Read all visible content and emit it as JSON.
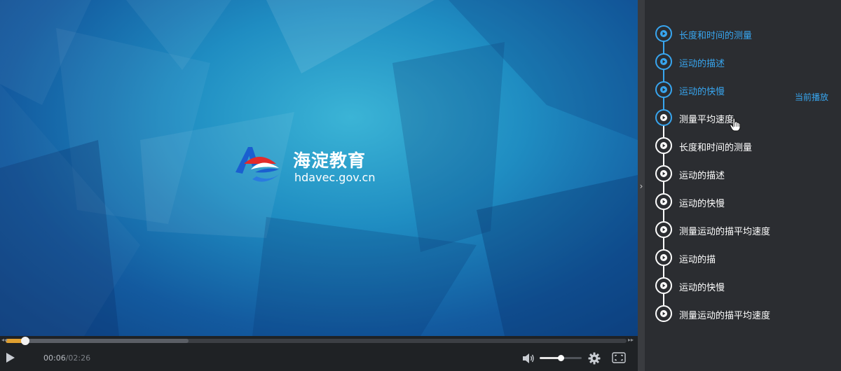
{
  "video": {
    "brand_title": "海淀教育",
    "brand_url": "hdavec.gov.cn",
    "background_color": "#1f8dc2"
  },
  "controls": {
    "play_icon": "play-icon",
    "current_time": "00:06",
    "duration": "/02:26",
    "progress_percent": 3.2,
    "buffered_percent": 29.5,
    "volume_percent": 50,
    "accent_color": "#e0a030"
  },
  "playlist": {
    "now_playing_label": "当前播放",
    "accent_color": "#38a6f0",
    "items": [
      {
        "label": "长度和时间的测量",
        "state": "watched"
      },
      {
        "label": "运动的描述",
        "state": "watched"
      },
      {
        "label": "运动的快慢",
        "state": "watched"
      },
      {
        "label": "测量平均速度",
        "state": "current"
      },
      {
        "label": "长度和时间的测量",
        "state": "unwatched"
      },
      {
        "label": "运动的描述",
        "state": "unwatched"
      },
      {
        "label": "运动的快慢",
        "state": "unwatched"
      },
      {
        "label": "测量运动的描平均速度",
        "state": "unwatched"
      },
      {
        "label": "运动的描",
        "state": "unwatched"
      },
      {
        "label": "运动的快慢",
        "state": "unwatched"
      },
      {
        "label": "测量运动的描平均速度",
        "state": "unwatched"
      }
    ]
  }
}
